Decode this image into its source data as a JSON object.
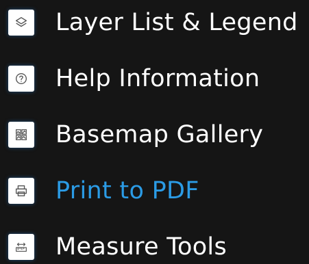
{
  "menu": {
    "items": [
      {
        "label": "Layer List & Legend",
        "icon": "layers-icon",
        "active": false
      },
      {
        "label": "Help Information",
        "icon": "help-circle-icon",
        "active": false
      },
      {
        "label": "Basemap Gallery",
        "icon": "basemap-grid-icon",
        "active": false
      },
      {
        "label": "Print to PDF",
        "icon": "printer-icon",
        "active": true
      },
      {
        "label": "Measure Tools",
        "icon": "ruler-measure-icon",
        "active": false
      }
    ]
  },
  "colors": {
    "background": "#151515",
    "text": "#ffffff",
    "active_text": "#2b9be5",
    "icon_background": "#ffffff",
    "icon_glyph": "#555555"
  }
}
